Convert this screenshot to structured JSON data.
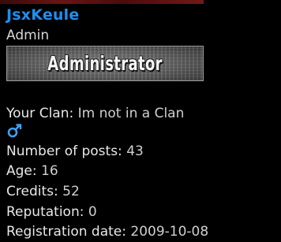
{
  "profile": {
    "username": "JsxKeule",
    "role": "Admin",
    "rank_image_text": "Administrator",
    "clan": {
      "label": "Your Clan:",
      "value": "Im not in a Clan"
    },
    "gender_icon": "male-symbol-icon",
    "posts": {
      "label": "Number of posts:",
      "value": "43"
    },
    "age": {
      "label": "Age:",
      "value": "16"
    },
    "credits": {
      "label": "Credits:",
      "value": "52"
    },
    "reputation": {
      "label": "Reputation:",
      "value": "0"
    },
    "registration": {
      "label": "Registration date:",
      "value": "2009-10-08"
    }
  },
  "colors": {
    "background": "#000000",
    "username": "#1e8ff0",
    "gender_icon": "#3fa0ee",
    "header_strip": "#6a1414"
  }
}
